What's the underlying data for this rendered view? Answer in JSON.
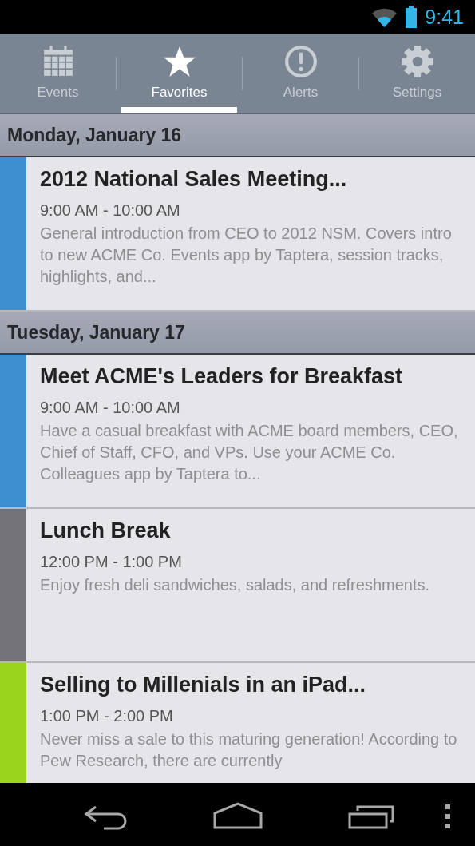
{
  "status_bar": {
    "time": "9:41"
  },
  "tabs": [
    {
      "label": "Events",
      "selected": false
    },
    {
      "label": "Favorites",
      "selected": true
    },
    {
      "label": "Alerts",
      "selected": false
    },
    {
      "label": "Settings",
      "selected": false
    }
  ],
  "days": [
    {
      "heading": "Monday, January 16",
      "events": [
        {
          "title": "2012 National Sales Meeting...",
          "time": "9:00 AM - 10:00 AM",
          "description": "General introduction from CEO to 2012 NSM. Covers intro to new ACME Co. Events app by Taptera, session tracks, highlights, and...",
          "color": "#3d8fcf"
        }
      ]
    },
    {
      "heading": "Tuesday, January 17",
      "events": [
        {
          "title": "Meet ACME's Leaders for Breakfast",
          "time": "9:00 AM - 10:00 AM",
          "description": "Have a casual breakfast with ACME board members, CEO, Chief of Staff, CFO, and VPs. Use your ACME Co. Colleagues app by Taptera to...",
          "color": "#3d8fcf"
        },
        {
          "title": "Lunch Break",
          "time": "12:00 PM - 1:00 PM",
          "description": "Enjoy fresh deli sandwiches, salads, and refreshments.",
          "color": "#747478"
        },
        {
          "title": "Selling to Millenials in an iPad...",
          "time": "1:00 PM - 2:00 PM",
          "description": "Never miss a sale to this maturing generation! According to Pew Research, there are currently",
          "color": "#9bd41c"
        }
      ]
    }
  ]
}
